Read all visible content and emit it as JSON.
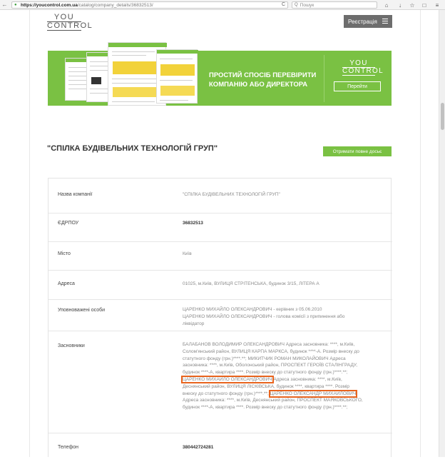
{
  "browser": {
    "url_host": "https://youcontrol.com.ua",
    "url_path": "/catalog/company_details/36832513/",
    "search_placeholder": "Пошук",
    "reload_glyph": "C",
    "search_glyph": "Q",
    "back_glyph": "←"
  },
  "header": {
    "logo_top": "YOU",
    "logo_bottom": "CONTROL",
    "register_label": "Реєстрація"
  },
  "banner": {
    "headline_line1": "ПРОСТИЙ СПОСІБ ПЕРЕВІРИТИ",
    "headline_line2": "КОМПАНІЮ АБО ДИРЕКТОРА",
    "logo_top": "YOU",
    "logo_bottom": "CONTROL",
    "button_label": "Перейти"
  },
  "company": {
    "title": "\"СПІЛКА БУДІВЕЛЬНИХ ТЕХНОЛОГІЙ ГРУП\"",
    "dossier_button": "Отримати повне досьє"
  },
  "details": {
    "name_label": "Назва компанії",
    "name_value": "\"СПІЛКА БУДІВЕЛЬНИХ ТЕХНОЛОГІЙ ГРУП\"",
    "edrpou_label": "ЄДРПОУ",
    "edrpou_value": "36832513",
    "city_label": "Місто",
    "city_value": "Київ",
    "address_label": "Адреса",
    "address_value": "01025, м.Київ, ВУЛИЦЯ СТРІТЕНСЬКА, будинок 3/15, ЛІТЕРА А",
    "authorized_label": "Уповноважені особи",
    "authorized_line1": "ЦАРЕНКО МИХАЙЛО ОЛЕКСАНДРОВИЧ - керівник з 05.06.2010",
    "authorized_line2": "ЦАРЕНКО МИХАЙЛО ОЛЕКСАНДРОВИЧ - голова комісії з припинення або",
    "authorized_line3": "ліквідатор",
    "founders_label": "Засновники",
    "founders_l1": "БАЛАБАНОВ ВОЛОДИМИР ОЛЕКСАНДРОВИЧ Адреса засновника: ****, м.Київ,",
    "founders_l2": "Солом'янський район, ВУЛИЦЯ КАРПА МАРКСА, будинок ****-А. Розмір внеску до",
    "founders_l3": "статутного фонду (грн.)****.**; МИКИТЧИК РОМАН МИКОЛАЙОВИЧ Адреса",
    "founders_l4": "засновника: ****, м.Київ, Оболонський район, ПРОСПЕКТ ГЕРОЇВ СТАЛІНГРАДУ,",
    "founders_l5": "будинок ****-А, квартира ****. Розмір внеску до статутного фонду (грн.)****.**;",
    "founders_hl1": "ЦАРЕНКО МИХАЙЛО ОЛЕКСАНДРОВИЧ",
    "founders_l6_rest": " Адреса засновника: ****, м.Київ,",
    "founders_l7": "Деснянський район, ВУЛИЦЯ ЛІСКІВСЬКА, будинок ****, квартира ****. Розмір",
    "founders_l8_pre": "внеску до статутного фонду (грн.)****.**; ",
    "founders_hl2": "ЦАРЕНКО ОЛЕКСАНДР МИХАЙЛОВИЧ",
    "founders_l9": "Адреса засновника: ****, м.Київ, Деснянський район, ПРОСПЕКТ МАЯКОВСЬКОГО,",
    "founders_l10": "будинок ****-А, квартира ****. Розмір внеску до статутного фонду (грн.)****.**;",
    "phone_label": "Телефон",
    "phone_value": "380442724281"
  },
  "colors": {
    "brand_green": "#7ac143",
    "highlight_orange": "#e8641e",
    "header_button": "#6d6d6d"
  }
}
